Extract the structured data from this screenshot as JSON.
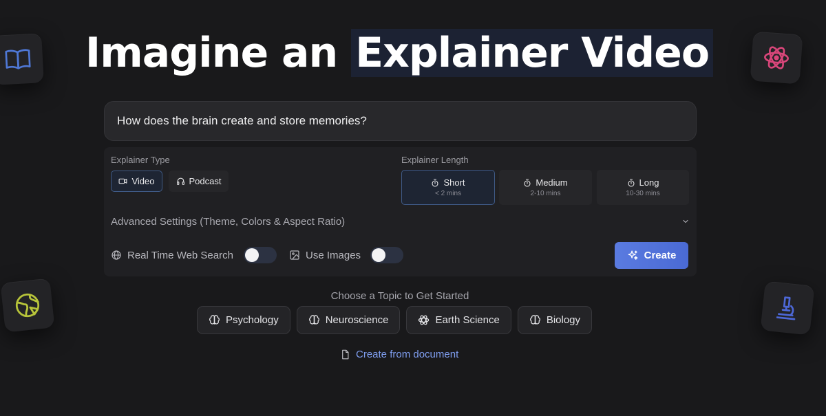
{
  "hero": {
    "title_prefix": "Imagine an ",
    "title_highlight": "Explainer Video"
  },
  "prompt": {
    "value": "How does the brain create and store memories?"
  },
  "explainer_type": {
    "label": "Explainer Type",
    "options": [
      {
        "label": "Video",
        "icon": "video-camera-icon",
        "selected": true
      },
      {
        "label": "Podcast",
        "icon": "headphones-icon",
        "selected": false
      }
    ]
  },
  "explainer_length": {
    "label": "Explainer Length",
    "options": [
      {
        "label": "Short",
        "sub": "< 2 mins",
        "selected": true
      },
      {
        "label": "Medium",
        "sub": "2-10 mins",
        "selected": false
      },
      {
        "label": "Long",
        "sub": "10-30 mins",
        "selected": false
      }
    ]
  },
  "advanced": {
    "label": "Advanced Settings (Theme, Colors & Aspect Ratio)"
  },
  "options": {
    "web_search_label": "Real Time Web Search",
    "web_search_on": false,
    "use_images_label": "Use Images",
    "use_images_on": false
  },
  "create_button": {
    "label": "Create"
  },
  "topics": {
    "heading": "Choose a Topic to Get Started",
    "items": [
      {
        "label": "Psychology",
        "icon": "brain-icon"
      },
      {
        "label": "Neuroscience",
        "icon": "brain-icon"
      },
      {
        "label": "Earth Science",
        "icon": "atom-icon"
      },
      {
        "label": "Biology",
        "icon": "brain-icon"
      }
    ]
  },
  "document_link": {
    "label": "Create from document"
  },
  "colors": {
    "background": "#19191b",
    "accent": "#5a7be0",
    "link": "#7f9ef0"
  }
}
